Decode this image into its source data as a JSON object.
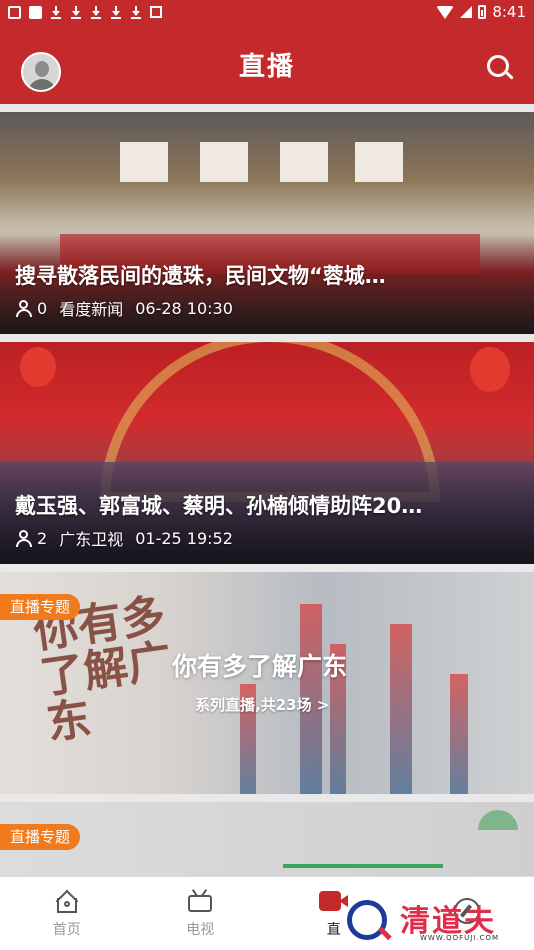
{
  "status_bar": {
    "time": "8:41"
  },
  "header": {
    "title": "直播"
  },
  "cards": [
    {
      "title": "搜寻散落民间的遗珠，民间文物“蓉城…",
      "viewers": "0",
      "source": "看度新闻",
      "time": "06-28 10:30"
    },
    {
      "title": "戴玉强、郭富城、蔡明、孙楠倾情助阵20…",
      "viewers": "2",
      "source": "广东卫视",
      "time": "01-25 19:52"
    }
  ],
  "topic_cards": [
    {
      "tag": "直播专题",
      "title": "你有多了解广东",
      "subtitle": "系列直播,共23场 >",
      "calligraphy": "你有多了解广东"
    },
    {
      "tag": "直播专题"
    }
  ],
  "tabbar": {
    "items": [
      {
        "label": "首页",
        "icon": "home-icon"
      },
      {
        "label": "电视",
        "icon": "tv-icon"
      },
      {
        "label": "直",
        "icon": "live-icon"
      },
      {
        "label": "",
        "icon": "compass-icon"
      }
    ]
  },
  "watermark": {
    "text": "清道夫",
    "url": "WWW.QDFUJI.COM"
  },
  "colors": {
    "brand_red": "#c42a2c",
    "tag_orange": "#f07a1c"
  }
}
